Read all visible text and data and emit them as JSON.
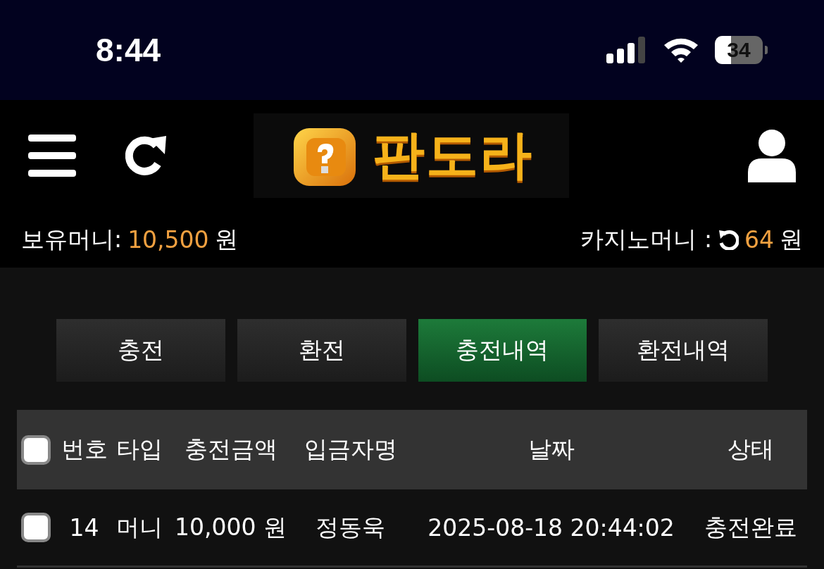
{
  "status_bar": {
    "time": "8:44",
    "battery": "34"
  },
  "header": {
    "logo_text": "판도라"
  },
  "balance": {
    "label": "보유머니:",
    "amount": "10,500",
    "unit": "원"
  },
  "casino_balance": {
    "label": "카지노머니 :",
    "amount": "64",
    "unit": "원"
  },
  "tabs": [
    {
      "label": "충전",
      "selected": false
    },
    {
      "label": "환전",
      "selected": false
    },
    {
      "label": "충전내역",
      "selected": true
    },
    {
      "label": "환전내역",
      "selected": false
    }
  ],
  "table": {
    "select_all_checked": false,
    "columns": [
      "번호",
      "타입",
      "충전금액",
      "입금자명",
      "날짜",
      "상태"
    ],
    "rows": [
      {
        "checked": false,
        "cells": [
          "14",
          "머니",
          "10,000 원",
          "정동욱",
          "2025-08-18 20:44:02",
          "충전완료"
        ]
      }
    ]
  }
}
